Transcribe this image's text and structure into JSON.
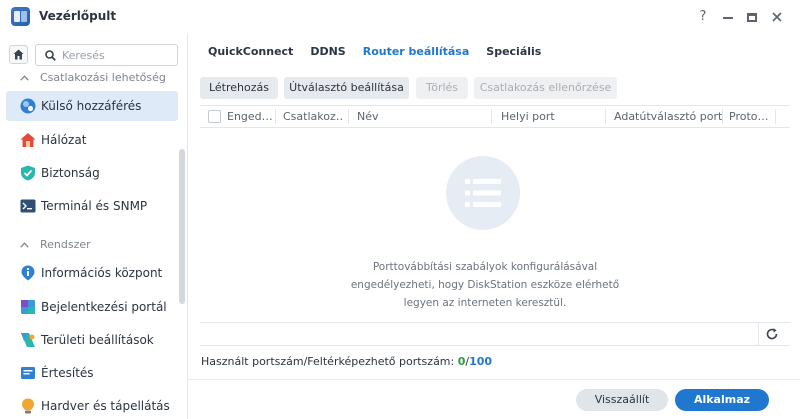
{
  "window": {
    "title": "Vezérlőpult",
    "help_label": "?"
  },
  "sidebar": {
    "search_placeholder": "Keresés",
    "section1": "Csatlakozási lehetőség",
    "section2": "Rendszer",
    "items": [
      {
        "label": "Külső hozzáférés",
        "icon": "external-access-icon",
        "active": true
      },
      {
        "label": "Hálózat",
        "icon": "network-house-icon"
      },
      {
        "label": "Biztonság",
        "icon": "shield-icon"
      },
      {
        "label": "Terminál és SNMP",
        "icon": "terminal-icon"
      },
      {
        "label": "Információs központ",
        "icon": "info-icon"
      },
      {
        "label": "Bejelentkezési portál",
        "icon": "login-portal-icon"
      },
      {
        "label": "Területi beállítások",
        "icon": "regional-settings-icon"
      },
      {
        "label": "Értesítés",
        "icon": "notification-icon"
      },
      {
        "label": "Hardver és tápellátás",
        "icon": "hardware-power-icon"
      }
    ]
  },
  "tabs": [
    {
      "label": "QuickConnect"
    },
    {
      "label": "DDNS"
    },
    {
      "label": "Router beállítása",
      "active": true
    },
    {
      "label": "Speciális"
    }
  ],
  "toolbar": {
    "create": "Létrehozás",
    "router_settings": "Útválasztó beállítása",
    "delete": "Törlés",
    "check_connection": "Csatlakozás ellenőrzése"
  },
  "table": {
    "columns": [
      "Enged…",
      "Csatlakoz…",
      "Név",
      "Helyi port",
      "Adatútválasztó port",
      "Proto…"
    ],
    "empty_message": "Porttovábbítási szabályok konfigurálásával engedélyezheti, hogy DiskStation eszköze elérhető legyen az interneten keresztül."
  },
  "ports": {
    "label": "Használt portszám/Feltérképezhető portszám:",
    "used": "0",
    "separator": "/",
    "available": "100"
  },
  "buttons": {
    "reset": "Visszaállít",
    "apply": "Alkalmaz"
  },
  "colors": {
    "accent": "#1f77d0",
    "active_bg": "#dfeaf8",
    "used_green": "#2a9d3c"
  }
}
